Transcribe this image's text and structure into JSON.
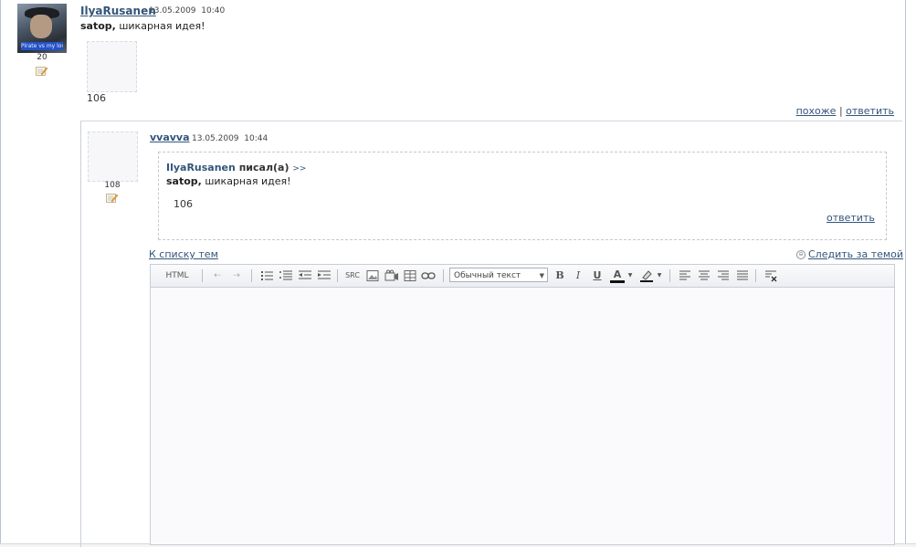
{
  "post": {
    "author": "IlyaRusanen",
    "date": "13.05.2009",
    "time": "10:40",
    "avatar_caption": "Pirate vs my love",
    "author_count": "20",
    "addressee": "satop,",
    "text": "шикарная идея!",
    "image_count": "106",
    "actions": {
      "similar": "похоже",
      "separator": "|",
      "reply": "ответить"
    }
  },
  "reply": {
    "author": "vvavva",
    "date": "13.05.2009",
    "time": "10:44",
    "author_count": "108",
    "quote": {
      "author": "IlyaRusanen",
      "wrote": "писал(а)",
      "arrow": ">>",
      "addressee": "satop,",
      "text": "шикарная идея!",
      "count": "106",
      "reply_label": "ответить"
    }
  },
  "nav": {
    "back_label": "К списку тем",
    "follow_label": "Следить за темой",
    "follow_icon": "⊝"
  },
  "editor": {
    "html_label": "HTML",
    "undo": "⇠",
    "redo": "⇢",
    "src_label": "SRC",
    "format_select": "Обычный текст",
    "select_arrow": "▼",
    "bold": "B",
    "italic": "I",
    "underline": "U",
    "font_color_label": "A",
    "content": ""
  }
}
